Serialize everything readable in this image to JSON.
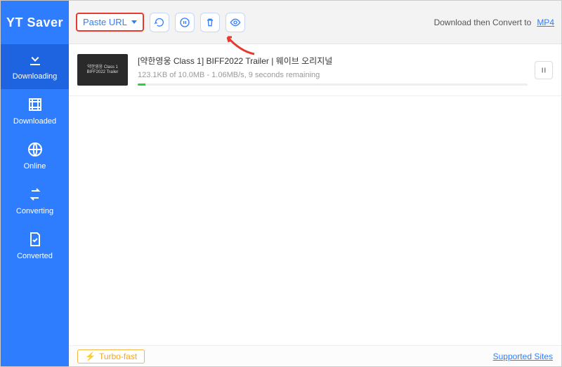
{
  "app_name": "YT Saver",
  "sidebar": {
    "items": [
      {
        "label": "Downloading"
      },
      {
        "label": "Downloaded"
      },
      {
        "label": "Online"
      },
      {
        "label": "Converting"
      },
      {
        "label": "Converted"
      }
    ]
  },
  "toolbar": {
    "paste_url_label": "Paste URL",
    "download_convert_label": "Download then Convert to",
    "convert_format": "MP4"
  },
  "download": {
    "title": "[약한영웅 Class 1] BIFF2022 Trailer | 웨이브 오리지널",
    "thumb_caption": "약한영웅 Class 1\nBIFF2022 Trailer",
    "stats": "123.1KB of 10.0MB -    1.06MB/s, 9 seconds remaining"
  },
  "footer": {
    "turbo_label": "Turbo-fast",
    "supported_sites_label": "Supported Sites"
  }
}
